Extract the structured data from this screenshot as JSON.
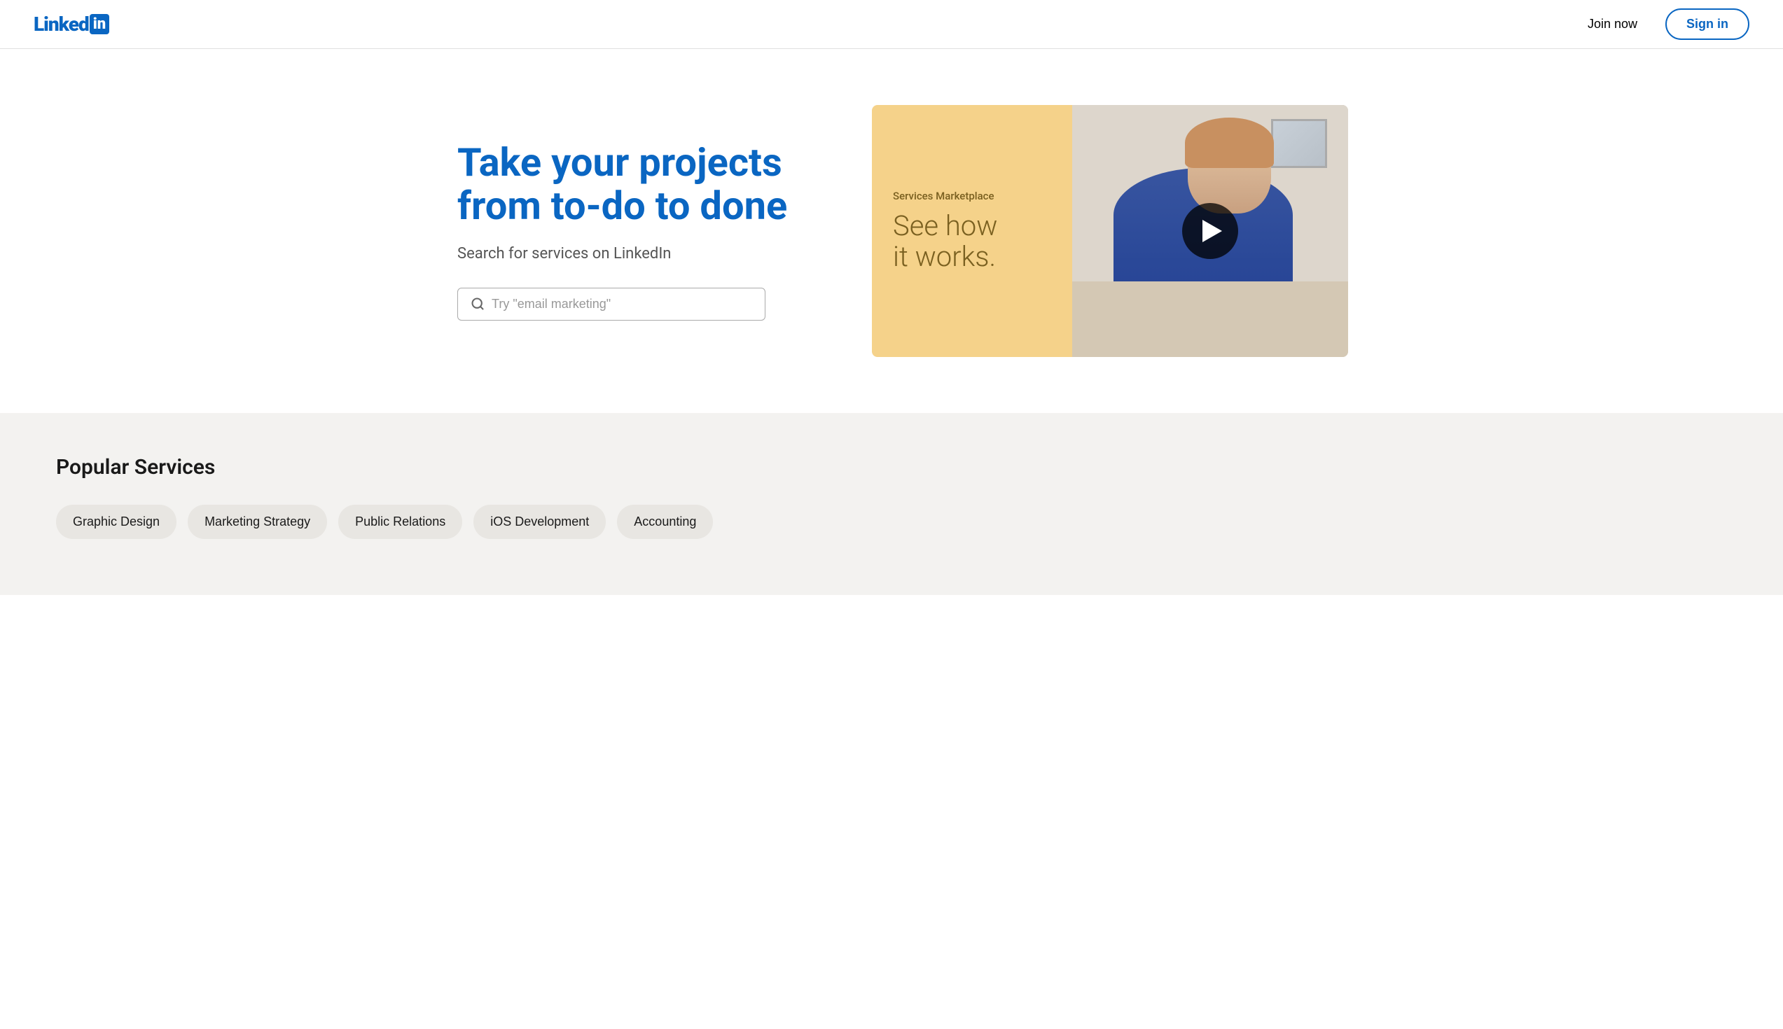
{
  "header": {
    "logo_text": "Linked",
    "logo_box": "in",
    "join_now_label": "Join now",
    "sign_in_label": "Sign in"
  },
  "hero": {
    "title": "Take your projects from to-do to done",
    "subtitle": "Search for services on LinkedIn",
    "search_placeholder": "Try \"email marketing\""
  },
  "video_panel": {
    "marketplace_label": "Services Marketplace",
    "title_line1": "See how",
    "title_line2": "it works."
  },
  "popular_services": {
    "section_title": "Popular Services",
    "chips": [
      {
        "label": "Graphic Design"
      },
      {
        "label": "Marketing Strategy"
      },
      {
        "label": "Public Relations"
      },
      {
        "label": "iOS Development"
      },
      {
        "label": "Accounting"
      }
    ]
  },
  "icons": {
    "search": "🔍",
    "play": "▶"
  }
}
